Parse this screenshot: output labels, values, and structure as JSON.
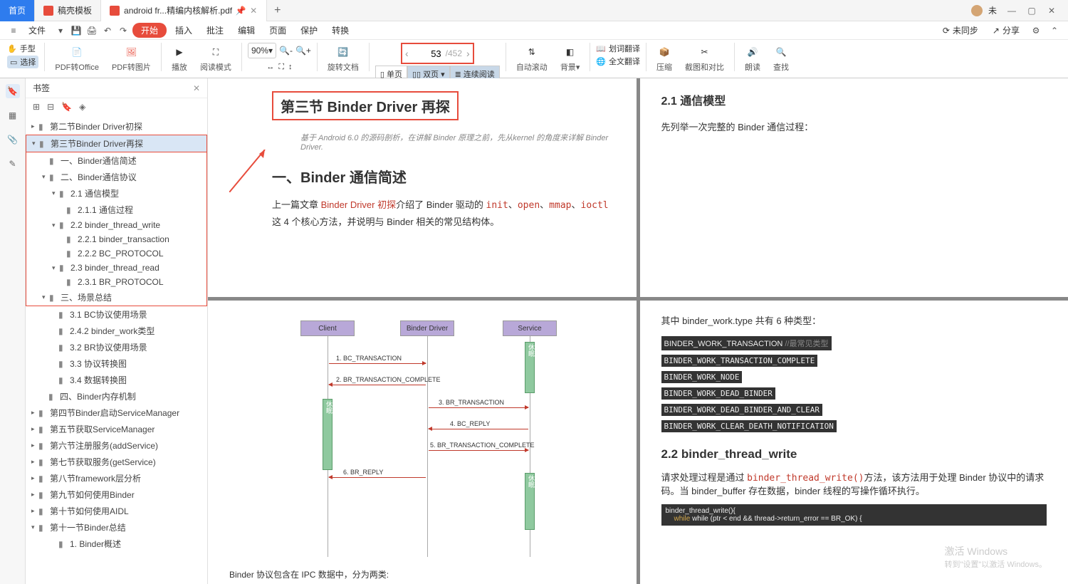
{
  "window": {
    "tab_home": "首页",
    "tab_template": "稿壳模板",
    "tab_pdf": "android fr...精编内核解析.pdf",
    "user": "未",
    "plus": "+"
  },
  "menu": {
    "file": "文件",
    "insert": "插入",
    "annotate": "批注",
    "edit": "编辑",
    "page": "页面",
    "protect": "保护",
    "convert": "转换",
    "start": "开始",
    "unsync": "未同步",
    "share": "分享"
  },
  "toolbar": {
    "hand": "手型",
    "select": "选择",
    "pdf2office": "PDF转Office",
    "pdf2pic": "PDF转图片",
    "play": "播放",
    "readmode": "阅读模式",
    "zoom": "90%",
    "rotate": "旋转文档",
    "single": "单页",
    "double": "双页",
    "continuous": "连续阅读",
    "page_current": "53",
    "page_total": "/452",
    "autoscroll": "自动滚动",
    "background": "背景",
    "wordtrans": "划词翻译",
    "fulltrans": "全文翻译",
    "compress": "压缩",
    "screenshot": "截图和对比",
    "read": "朗读",
    "find": "查找"
  },
  "bookmarks": {
    "title": "书签",
    "items": {
      "s1": "第二节Binder Driver初探",
      "s2": "第三节Binder Driver再探",
      "s2_1": "一、Binder通信简述",
      "s2_2": "二、Binder通信协议",
      "s2_2_1": "2.1 通信模型",
      "s2_2_1_1": "2.1.1 通信过程",
      "s2_2_2": "2.2 binder_thread_write",
      "s2_2_2_1": "2.2.1 binder_transaction",
      "s2_2_2_2": "2.2.2 BC_PROTOCOL",
      "s2_2_3": "2.3 binder_thread_read",
      "s2_2_3_1": "2.3.1 BR_PROTOCOL",
      "s2_3": "三、场景总结",
      "s2_3_1": "3.1 BC协议使用场景",
      "s2_3_2": "2.4.2 binder_work类型",
      "s2_3_3": "3.2 BR协议使用场景",
      "s2_3_4": "3.3 协议转换图",
      "s2_3_5": "3.4 数据转换图",
      "s2_4": "四、Binder内存机制",
      "s4": "第四节Binder启动ServiceManager",
      "s5": "第五节获取ServiceManager",
      "s6": "第六节注册服务(addService)",
      "s7": "第七节获取服务(getService)",
      "s8": "第八节framework层分析",
      "s9": "第九节如何使用Binder",
      "s10": "第十节如何使用AIDL",
      "s11": "第十一节Binder总结",
      "s11_1": "1. Binder概述"
    }
  },
  "doc": {
    "p1_title": "第三节 Binder Driver 再探",
    "p1_sub": "基于 Android 6.0 的源码剖析，在讲解 Binder 原理之前，先从kernel 的角度来详解 Binder Driver.",
    "p1_h2": "一、Binder 通信简述",
    "p1_body1": "上一篇文章 ",
    "p1_link": "Binder Driver 初探",
    "p1_body2": "介绍了 Binder 驱动的 ",
    "p1_c1": "init",
    "p1_c2": "open",
    "p1_c3": "mmap",
    "p1_c4": "ioctl",
    "p1_body3": " 这 4 个核心方法，并说明与 Binder 相关的常见结构体。",
    "p2_h3": "2.1  通信模型",
    "p2_body": "先列举一次完整的 Binder 通信过程：",
    "p3_actors": {
      "client": "Client",
      "driver": "Binder Driver",
      "service": "Service"
    },
    "p3_msgs": {
      "m1": "1. BC_TRANSACTION",
      "m2": "2. BR_TRANSACTION_COMPLETE",
      "m3": "3. BR_TRANSACTION",
      "m4": "4. BC_REPLY",
      "m5": "5. BR_TRANSACTION_COMPLETE",
      "m6": "6. BR_REPLY"
    },
    "p3_sleep": "休眠",
    "p3_foot": "Binder 协议包含在 IPC 数据中，分为两类:",
    "p4_intro": "其中 binder_work.type 共有 6 种类型：",
    "p4_t1": "BINDER_WORK_TRANSACTION",
    "p4_t1c": " //最常见类型",
    "p4_t2": "BINDER_WORK_TRANSACTION_COMPLETE",
    "p4_t3": "BINDER_WORK_NODE",
    "p4_t4": "BINDER_WORK_DEAD_BINDER",
    "p4_t5": "BINDER_WORK_DEAD_BINDER_AND_CLEAR",
    "p4_t6": "BINDER_WORK_CLEAR_DEATH_NOTIFICATION",
    "p4_h3": "2.2 binder_thread_write",
    "p4_body": "请求处理过程是通过 ",
    "p4_fn": "binder_thread_write()",
    "p4_body2": "方法，该方法用于处理 Binder 协议中的请求码。当 binder_buffer 存在数据，binder 线程的写操作循环执行。",
    "p4_code1": "binder_thread_write(){",
    "p4_code2": "while (ptr < end && thread->return_error == BR_OK) {"
  },
  "watermark": {
    "l1": "激活 Windows",
    "l2": "转到\"设置\"以激活 Windows。"
  }
}
